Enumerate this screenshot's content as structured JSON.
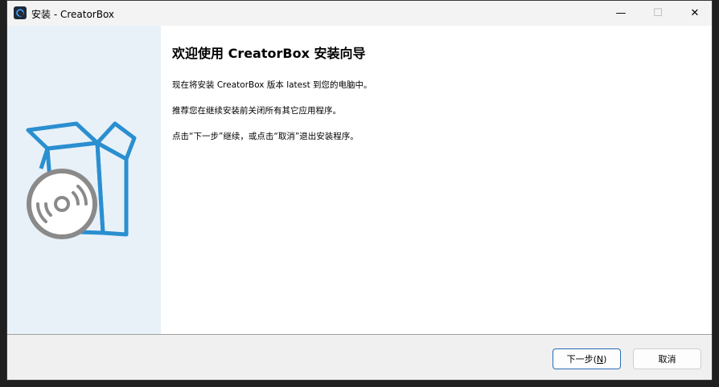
{
  "window": {
    "title": "安装 - CreatorBox",
    "controls": {
      "minimize": "—",
      "maximize": "☐",
      "close": "✕"
    }
  },
  "main": {
    "heading": "欢迎使用 CreatorBox 安装向导",
    "paragraphs": [
      "现在将安装 CreatorBox 版本 latest 到您的电脑中。",
      "推荐您在继续安装前关闭所有其它应用程序。",
      "点击“下一步”继续，或点击“取消”退出安装程序。"
    ]
  },
  "footer": {
    "next_label_pre": "下一步(",
    "next_mnemonic": "N",
    "next_label_post": ")",
    "cancel_label": "取消"
  },
  "icons": {
    "app": "creatorbox-app-icon",
    "side_graphic": "box-with-disc-icon"
  },
  "colors": {
    "side_panel": "#e8f1f8",
    "icon_blue": "#2a8fd0",
    "next_border": "#2a6fb4"
  }
}
